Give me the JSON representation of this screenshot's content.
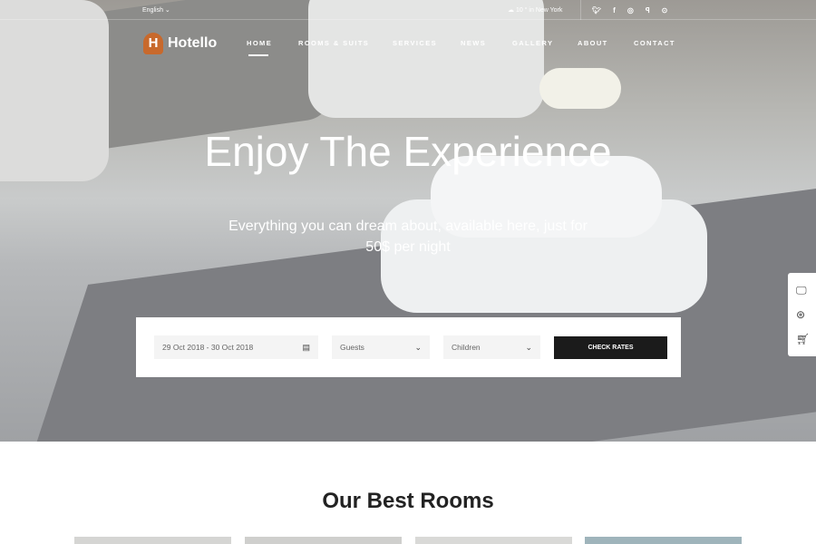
{
  "topbar": {
    "language": "English",
    "weather": "10 ° in New York",
    "socials": [
      "twitter-icon",
      "facebook-icon",
      "instagram-icon",
      "foursquare-icon",
      "tripadvisor-icon"
    ]
  },
  "brand": {
    "name": "Hotello",
    "color": "#c8692c"
  },
  "nav": [
    "HOME",
    "ROOMS & SUITS",
    "SERVICES",
    "NEWS",
    "GALLERY",
    "ABOUT",
    "CONTACT"
  ],
  "hero": {
    "title": "Enjoy The Experience",
    "subtitle": "Everything you can dream about, available here, just for 50$ per night"
  },
  "booking": {
    "dates": "29 Oct 2018 - 30 Oct 2018",
    "guests": "Guests",
    "children": "Children",
    "button": "CHECK RATES"
  },
  "side_tools": [
    "monitor-icon",
    "support-icon",
    "cart-icon"
  ],
  "section": {
    "title": "Our Best Rooms"
  }
}
